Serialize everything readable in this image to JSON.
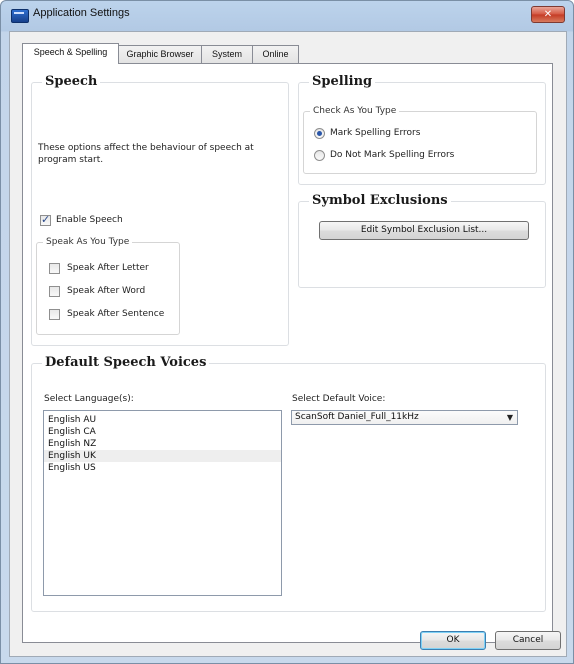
{
  "window": {
    "title": "Application Settings",
    "close_glyph": "✕"
  },
  "tabs": [
    {
      "label": "Speech & Spelling",
      "active": true
    },
    {
      "label": "Graphic Browser",
      "active": false
    },
    {
      "label": "System",
      "active": false
    },
    {
      "label": "Online",
      "active": false
    }
  ],
  "speech": {
    "title": "Speech",
    "description": "These options affect the behaviour of speech at program start.",
    "enable_speech": {
      "label": "Enable Speech",
      "checked": true
    },
    "speak_as_you_type": {
      "title": "Speak As You Type",
      "options": [
        {
          "label": "Speak After Letter",
          "checked": false
        },
        {
          "label": "Speak After Word",
          "checked": false
        },
        {
          "label": "Speak After Sentence",
          "checked": false
        }
      ]
    }
  },
  "spelling": {
    "title": "Spelling",
    "check_as_you_type": {
      "title": "Check As You Type",
      "options": [
        {
          "label": "Mark Spelling Errors",
          "selected": true
        },
        {
          "label": "Do Not Mark Spelling Errors",
          "selected": false
        }
      ]
    }
  },
  "symbol_exclusions": {
    "title": "Symbol Exclusions",
    "edit_button": "Edit Symbol Exclusion List..."
  },
  "default_voices": {
    "title": "Default Speech Voices",
    "language_label": "Select Language(s):",
    "languages": [
      "English AU",
      "English CA",
      "English NZ",
      "English UK",
      "English US"
    ],
    "selected_language": "English UK",
    "voice_label": "Select Default Voice:",
    "voice_value": "ScanSoft Daniel_Full_11kHz"
  },
  "footer": {
    "ok": "OK",
    "cancel": "Cancel"
  }
}
